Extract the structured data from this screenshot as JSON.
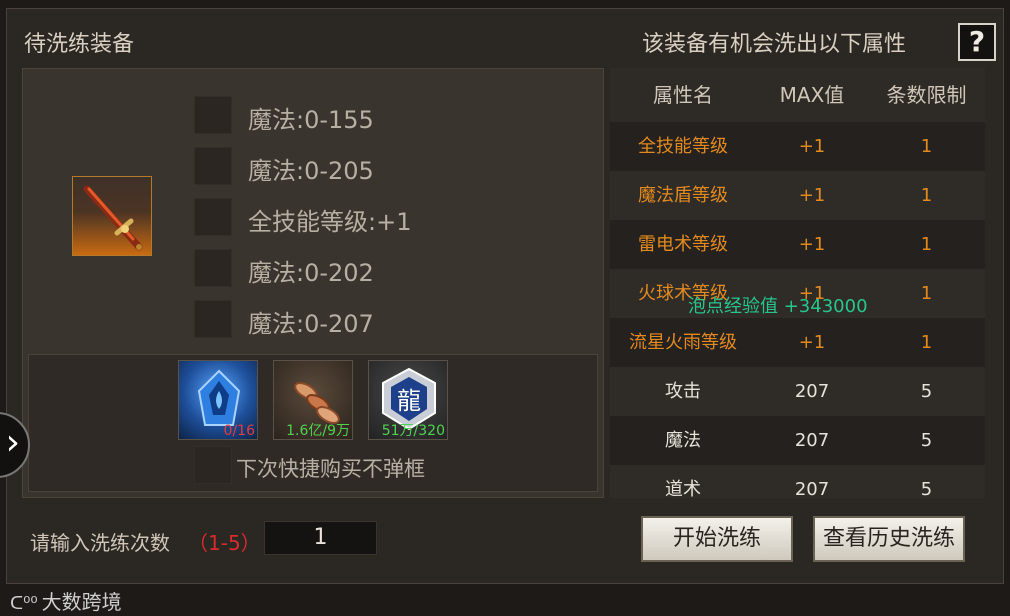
{
  "titles": {
    "left": "待洗练装备",
    "right": "该装备有机会洗出以下属性",
    "help": "?"
  },
  "equipment": {
    "icon": "sword-icon",
    "attributes": [
      {
        "text": "魔法:0-155"
      },
      {
        "text": "魔法:0-205"
      },
      {
        "text": "全技能等级:+1"
      },
      {
        "text": "魔法:0-202"
      },
      {
        "text": "魔法:0-207"
      }
    ]
  },
  "items": [
    {
      "icon": "blue-crystal-icon",
      "count": "0/16",
      "count_color": "#e23c3c"
    },
    {
      "icon": "gold-coins-icon",
      "count": "1.6亿/9万",
      "count_color": "#4fd34f"
    },
    {
      "icon": "dragon-token-icon",
      "count": "51万/320",
      "count_color": "#4fd34f"
    }
  ],
  "no_popup_label": "下次快捷购买不弹框",
  "table": {
    "headers": [
      "属性名",
      "MAX值",
      "条数限制"
    ],
    "rows": [
      {
        "name": "全技能等级",
        "max": "+1",
        "limit": "1",
        "style": "orange"
      },
      {
        "name": "魔法盾等级",
        "max": "+1",
        "limit": "1",
        "style": "orange"
      },
      {
        "name": "雷电术等级",
        "max": "+1",
        "limit": "1",
        "style": "orange"
      },
      {
        "name": "火球术等级",
        "max": "+1",
        "limit": "1",
        "style": "orange"
      },
      {
        "name": "流星火雨等级",
        "max": "+1",
        "limit": "1",
        "style": "orange"
      },
      {
        "name": "攻击",
        "max": "207",
        "limit": "5",
        "style": "white"
      },
      {
        "name": "魔法",
        "max": "207",
        "limit": "5",
        "style": "white"
      },
      {
        "name": "道术",
        "max": "207",
        "limit": "5",
        "style": "white"
      }
    ]
  },
  "exp_popup": "泡点经验值 +343000",
  "refine": {
    "count_label": "请输入洗练次数",
    "count_range": "（1-5）",
    "count_value": "1",
    "start_button": "开始洗练",
    "history_button": "查看历史洗练"
  },
  "watermark": "大数跨境",
  "colors": {
    "orange_text": "#e38a1f",
    "exp_green": "#27c68d",
    "range_red": "#d92b2b"
  }
}
